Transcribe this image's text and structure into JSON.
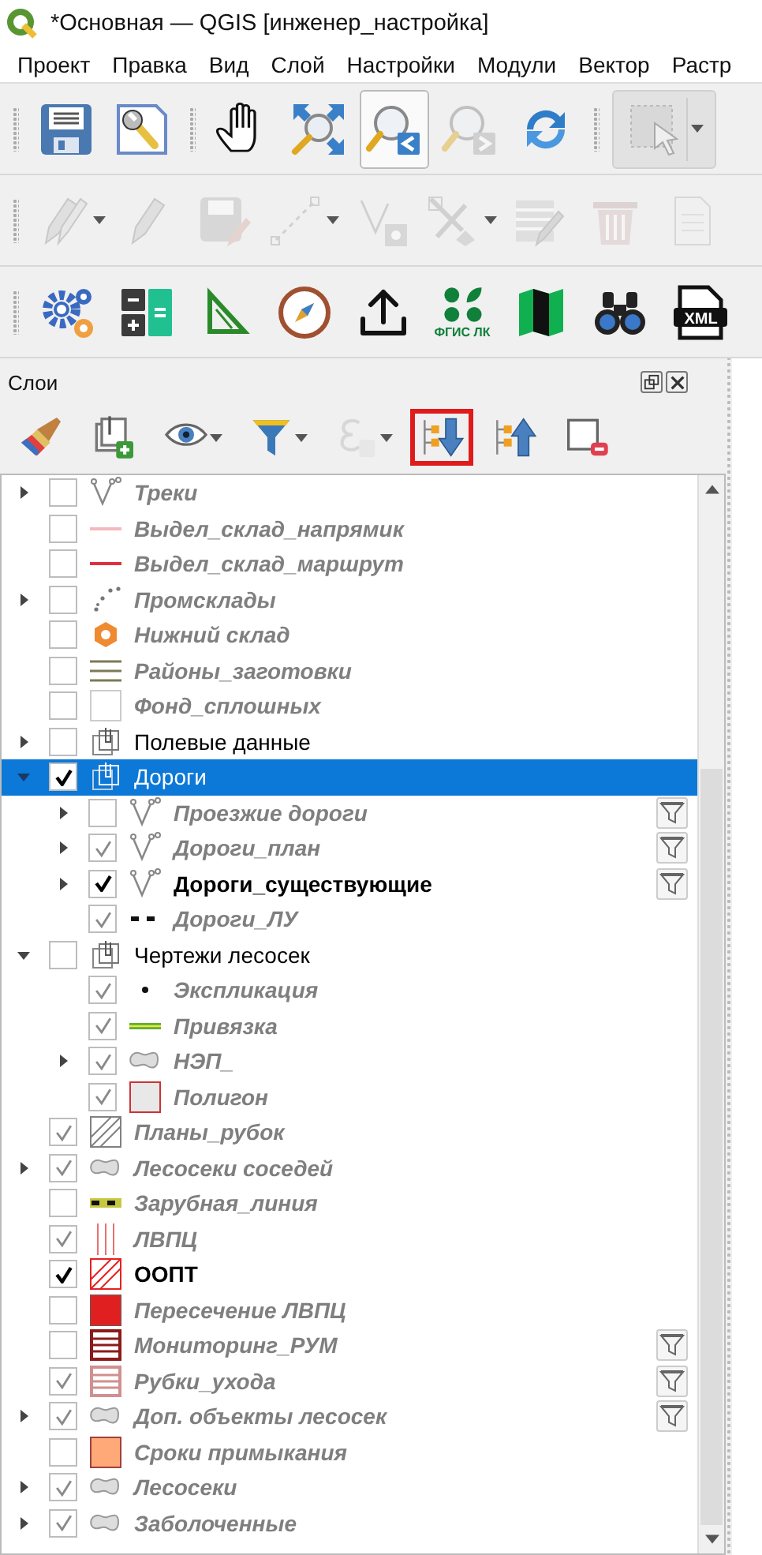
{
  "window": {
    "title": "*Основная — QGIS [инженер_настройка]"
  },
  "menu": [
    "Проект",
    "Правка",
    "Вид",
    "Слой",
    "Настройки",
    "Модули",
    "Вектор",
    "Растр"
  ],
  "toolbars": {
    "map_navigation": [
      {
        "pressed": false,
        "disabled": false
      },
      {
        "pressed": false,
        "disabled": false
      },
      {
        "pressed": false,
        "disabled": false
      },
      {
        "pressed": false,
        "disabled": false
      },
      {
        "pressed": true,
        "disabled": false
      },
      {
        "pressed": false,
        "disabled": true
      },
      {
        "pressed": false,
        "disabled": false
      },
      {
        "pressed": false,
        "disabled": true
      }
    ],
    "digitizing": [
      {
        "disabled": true
      },
      {
        "disabled": true
      },
      {
        "disabled": true
      },
      {
        "disabled": true
      },
      {
        "disabled": true
      },
      {
        "disabled": true
      },
      {
        "disabled": true
      },
      {
        "disabled": true
      },
      {
        "disabled": true
      }
    ],
    "plugins": {
      "fgis_caption": "ФГИС ЛК",
      "xml_caption": "XML"
    }
  },
  "layers_panel": {
    "title": "Слои",
    "toolbar": [
      {
        "disabled": false,
        "highlighted": false
      },
      {
        "disabled": false,
        "highlighted": false
      },
      {
        "disabled": false,
        "highlighted": false
      },
      {
        "disabled": false,
        "highlighted": false
      },
      {
        "disabled": true,
        "highlighted": false
      },
      {
        "disabled": false,
        "highlighted": true
      },
      {
        "disabled": false,
        "highlighted": false
      },
      {
        "disabled": false,
        "highlighted": false
      }
    ],
    "tree": [
      {
        "name": "Треки",
        "kind": "vertices",
        "active": false,
        "checked": false,
        "expanded": false,
        "filter": false,
        "selected": false
      },
      {
        "name": "Выдел_склад_напрямик",
        "kind": "line",
        "color": "#f4b8c0",
        "active": false,
        "checked": false,
        "filter": false,
        "selected": false
      },
      {
        "name": "Выдел_склад_маршрут",
        "kind": "line",
        "color": "#e03040",
        "active": false,
        "checked": false,
        "filter": false,
        "selected": false
      },
      {
        "name": "Промсклады",
        "kind": "points",
        "active": false,
        "checked": false,
        "expanded": false,
        "filter": false,
        "selected": false
      },
      {
        "name": "Нижний склад",
        "kind": "hexagon",
        "color": "#f08a30",
        "active": false,
        "checked": false,
        "filter": false,
        "selected": false
      },
      {
        "name": "Районы_заготовки",
        "kind": "stripes",
        "color": "#7a7a58",
        "active": false,
        "checked": false,
        "filter": false,
        "selected": false
      },
      {
        "name": "Фонд_сплошных",
        "kind": "box",
        "active": false,
        "checked": false,
        "filter": false,
        "selected": false
      },
      {
        "name": "Полевые данные",
        "kind": "group",
        "checked": false,
        "expanded": false,
        "filter": false,
        "selected": false
      },
      {
        "name": "Дороги",
        "kind": "group",
        "checked": true,
        "expanded": true,
        "filter": false,
        "selected": true,
        "children": [
          {
            "name": "Проезжие дороги",
            "kind": "vertices",
            "active": false,
            "checked": false,
            "expanded": false,
            "filter": true,
            "selected": false
          },
          {
            "name": "Дороги_план",
            "kind": "vertices",
            "active": false,
            "checked": true,
            "expanded": false,
            "filter": true,
            "selected": false
          },
          {
            "name": "Дороги_существующие",
            "kind": "vertices",
            "active": true,
            "checked": true,
            "expanded": false,
            "filter": true,
            "selected": false
          },
          {
            "name": "Дороги_ЛУ",
            "kind": "dashed",
            "active": false,
            "checked": true,
            "filter": false,
            "selected": false
          }
        ]
      },
      {
        "name": "Чертежи лесосек",
        "kind": "group",
        "checked": false,
        "expanded": true,
        "filter": false,
        "selected": false,
        "children": [
          {
            "name": "Экспликация",
            "kind": "dot",
            "active": false,
            "checked": true,
            "filter": false,
            "selected": false
          },
          {
            "name": "Привязка",
            "kind": "double-line",
            "color": "#5cb030",
            "active": false,
            "checked": true,
            "filter": false,
            "selected": false
          },
          {
            "name": "НЭП_",
            "kind": "blob",
            "active": false,
            "checked": true,
            "expanded": false,
            "filter": false,
            "selected": false
          },
          {
            "name": "Полигон",
            "kind": "box",
            "color": "#e8e8e8",
            "active": false,
            "checked": true,
            "filter": false,
            "selected": false
          }
        ]
      },
      {
        "name": "Планы_рубок",
        "kind": "hatch",
        "color": "#808080",
        "active": false,
        "checked": true,
        "filter": false,
        "selected": false
      },
      {
        "name": "Лесосеки соседей",
        "kind": "blob",
        "active": false,
        "checked": true,
        "expanded": false,
        "filter": false,
        "selected": false
      },
      {
        "name": "Зарубная_линия",
        "kind": "dashed",
        "color": "#c8c840",
        "active": false,
        "checked": false,
        "filter": false,
        "selected": false
      },
      {
        "name": "ЛВПЦ",
        "kind": "vlines",
        "color": "#e87070",
        "active": false,
        "checked": true,
        "filter": false,
        "selected": false
      },
      {
        "name": "ООПТ",
        "kind": "hatch",
        "color": "#e82020",
        "active": true,
        "checked": true,
        "filter": false,
        "selected": false
      },
      {
        "name": "Пересечение ЛВПЦ",
        "kind": "box",
        "color": "#e02020",
        "active": false,
        "checked": false,
        "filter": false,
        "selected": false
      },
      {
        "name": "Мониторинг_РУМ",
        "kind": "grid",
        "color": "#8b1a1a",
        "active": false,
        "checked": false,
        "filter": true,
        "selected": false
      },
      {
        "name": "Рубки_ухода",
        "kind": "grid",
        "color": "#d09090",
        "active": false,
        "checked": true,
        "filter": true,
        "selected": false
      },
      {
        "name": "Доп. объекты лесосек",
        "kind": "blob",
        "active": false,
        "checked": true,
        "expanded": false,
        "filter": true,
        "selected": false
      },
      {
        "name": "Сроки примыкания",
        "kind": "box",
        "color": "#ffa878",
        "active": false,
        "checked": false,
        "filter": false,
        "selected": false
      },
      {
        "name": "Лесосеки",
        "kind": "blob",
        "active": false,
        "checked": true,
        "expanded": false,
        "filter": false,
        "selected": false
      },
      {
        "name": "Заболоченные",
        "kind": "blob",
        "active": false,
        "checked": true,
        "expanded": false,
        "filter": false,
        "selected": false
      }
    ]
  }
}
